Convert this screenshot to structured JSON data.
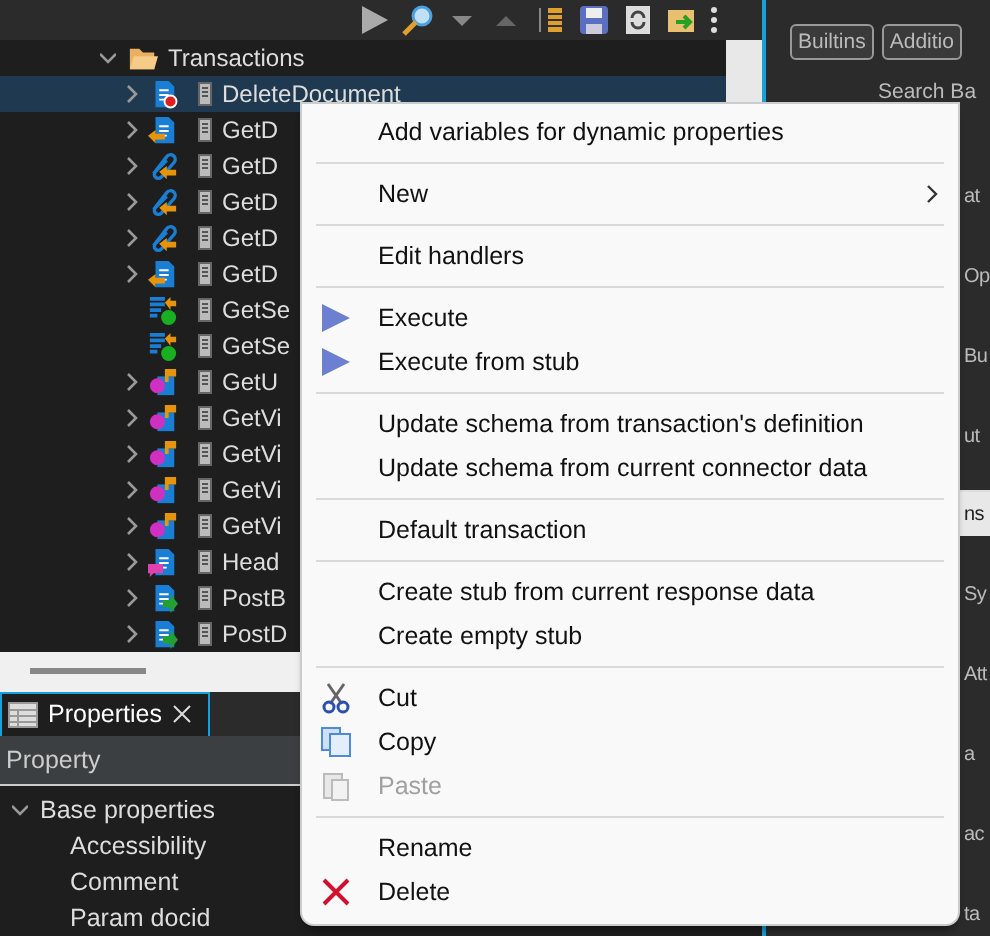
{
  "tree": {
    "label": "Transactions",
    "expanded": true,
    "children": [
      {
        "label": "DeleteDocument",
        "kind": "delete",
        "expandable": true,
        "selected": true
      },
      {
        "label": "GetD",
        "kind": "get",
        "expandable": true,
        "selected": false
      },
      {
        "label": "GetD",
        "kind": "link",
        "expandable": true,
        "selected": false
      },
      {
        "label": "GetD",
        "kind": "link",
        "expandable": true,
        "selected": false
      },
      {
        "label": "GetD",
        "kind": "link",
        "expandable": true,
        "selected": false
      },
      {
        "label": "GetD",
        "kind": "get",
        "expandable": true,
        "selected": false
      },
      {
        "label": "GetSe",
        "kind": "schema",
        "expandable": false,
        "selected": false
      },
      {
        "label": "GetSe",
        "kind": "schema",
        "expandable": false,
        "selected": false
      },
      {
        "label": "GetU",
        "kind": "user",
        "expandable": true,
        "selected": false
      },
      {
        "label": "GetVi",
        "kind": "user",
        "expandable": true,
        "selected": false
      },
      {
        "label": "GetVi",
        "kind": "user",
        "expandable": true,
        "selected": false
      },
      {
        "label": "GetVi",
        "kind": "user",
        "expandable": true,
        "selected": false
      },
      {
        "label": "GetVi",
        "kind": "user",
        "expandable": true,
        "selected": false
      },
      {
        "label": "Head",
        "kind": "head",
        "expandable": true,
        "selected": false
      },
      {
        "label": "PostB",
        "kind": "post",
        "expandable": true,
        "selected": false
      },
      {
        "label": "PostD",
        "kind": "post",
        "expandable": true,
        "selected": false
      }
    ]
  },
  "properties": {
    "tab": "Properties",
    "column": "Property",
    "group": {
      "label": "Base properties",
      "expanded": true,
      "children": [
        "Accessibility",
        "Comment",
        "Param docid"
      ]
    }
  },
  "right_panel": {
    "buttons": [
      "Builtins",
      "Additio"
    ],
    "search": "Search Ba",
    "fragments": [
      {
        "text": "at",
        "kind": "plain"
      },
      {
        "text": "Op",
        "kind": "plain"
      },
      {
        "text": "Bu",
        "kind": "plain"
      },
      {
        "text": "ut",
        "kind": "plain"
      },
      {
        "text": "ns",
        "kind": "header"
      },
      {
        "text": "Sy",
        "kind": "plain"
      },
      {
        "text": "Att",
        "kind": "plain"
      },
      {
        "text": "a",
        "kind": "plain"
      },
      {
        "text": "ac",
        "kind": "plain"
      },
      {
        "text": "ta",
        "kind": "plain"
      }
    ]
  },
  "context_menu": {
    "groups": [
      [
        {
          "label": "Add variables for dynamic properties",
          "kind": "plain",
          "submenu": false,
          "disabled": false
        }
      ],
      [
        {
          "label": "New",
          "kind": "plain",
          "submenu": true,
          "disabled": false
        }
      ],
      [
        {
          "label": "Edit handlers",
          "kind": "plain",
          "submenu": false,
          "disabled": false
        }
      ],
      [
        {
          "label": "Execute",
          "kind": "execute",
          "submenu": false,
          "disabled": false
        },
        {
          "label": "Execute from stub",
          "kind": "execute",
          "submenu": false,
          "disabled": false
        }
      ],
      [
        {
          "label": "Update schema from transaction's definition",
          "kind": "plain",
          "submenu": false,
          "disabled": false
        },
        {
          "label": "Update schema from current connector data",
          "kind": "plain",
          "submenu": false,
          "disabled": false
        }
      ],
      [
        {
          "label": "Default transaction",
          "kind": "plain",
          "submenu": false,
          "disabled": false
        }
      ],
      [
        {
          "label": "Create stub from current response data",
          "kind": "plain",
          "submenu": false,
          "disabled": false
        },
        {
          "label": "Create empty stub",
          "kind": "plain",
          "submenu": false,
          "disabled": false
        }
      ],
      [
        {
          "label": "Cut",
          "kind": "cut",
          "submenu": false,
          "disabled": false
        },
        {
          "label": "Copy",
          "kind": "copy",
          "submenu": false,
          "disabled": false
        },
        {
          "label": "Paste",
          "kind": "paste",
          "submenu": false,
          "disabled": true
        }
      ],
      [
        {
          "label": "Rename",
          "kind": "plain",
          "submenu": false,
          "disabled": false
        },
        {
          "label": "Delete",
          "kind": "delete",
          "submenu": false,
          "disabled": false
        }
      ]
    ]
  }
}
